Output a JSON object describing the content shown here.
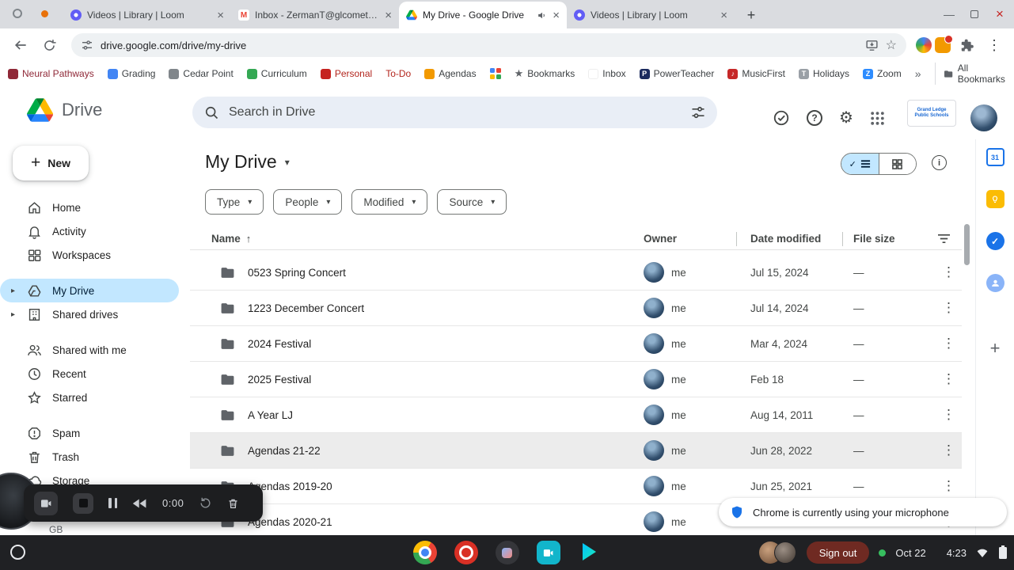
{
  "tabs": [
    {
      "title": "Videos | Library | Loom"
    },
    {
      "title": "Inbox - ZermanT@glcomets.ne"
    },
    {
      "title": "My Drive - Google Drive"
    },
    {
      "title": "Videos | Library | Loom"
    }
  ],
  "toolbar": {
    "url": "drive.google.com/drive/my-drive"
  },
  "bookmarks": {
    "items": [
      {
        "label": "Neural Pathways"
      },
      {
        "label": "Grading"
      },
      {
        "label": "Cedar Point"
      },
      {
        "label": "Curriculum"
      },
      {
        "label": "Personal"
      },
      {
        "label": "To-Do"
      },
      {
        "label": "Agendas"
      },
      {
        "label": "Bookmarks"
      },
      {
        "label": "Inbox"
      },
      {
        "label": "PowerTeacher"
      },
      {
        "label": "MusicFirst"
      },
      {
        "label": "Holidays"
      },
      {
        "label": "Zoom"
      }
    ],
    "all_bookmarks": "All Bookmarks"
  },
  "drive": {
    "app_name": "Drive",
    "search_placeholder": "Search in Drive",
    "org_logo_text": "Grand Ledge Public Schools",
    "new_button": "New",
    "sidebar_items": [
      {
        "label": "Home"
      },
      {
        "label": "Activity"
      },
      {
        "label": "Workspaces"
      },
      {
        "label": "My Drive"
      },
      {
        "label": "Shared drives"
      },
      {
        "label": "Shared with me"
      },
      {
        "label": "Recent"
      },
      {
        "label": "Starred"
      },
      {
        "label": "Spam"
      },
      {
        "label": "Trash"
      },
      {
        "label": "Storage"
      }
    ],
    "storage_fragment": "GB",
    "title": "My Drive",
    "filters": [
      {
        "label": "Type"
      },
      {
        "label": "People"
      },
      {
        "label": "Modified"
      },
      {
        "label": "Source"
      }
    ],
    "columns": {
      "name": "Name",
      "owner": "Owner",
      "modified": "Date modified",
      "size": "File size"
    },
    "rows": [
      {
        "name": "0523 Spring Concert",
        "owner": "me",
        "modified": "Jul 15, 2024",
        "size": "—"
      },
      {
        "name": "1223 December Concert",
        "owner": "me",
        "modified": "Jul 14, 2024",
        "size": "—"
      },
      {
        "name": "2024 Festival",
        "owner": "me",
        "modified": "Mar 4, 2024",
        "size": "—"
      },
      {
        "name": "2025 Festival",
        "owner": "me",
        "modified": "Feb 18",
        "size": "—"
      },
      {
        "name": "A Year LJ",
        "owner": "me",
        "modified": "Aug 14, 2011",
        "size": "—"
      },
      {
        "name": "Agendas 21-22",
        "owner": "me",
        "modified": "Jun 28, 2022",
        "size": "—"
      },
      {
        "name": "Agendas 2019-20",
        "owner": "me",
        "modified": "Jun 25, 2021",
        "size": "—"
      },
      {
        "name": "Agendas 2020-21",
        "owner": "me",
        "modified": "",
        "size": ""
      }
    ]
  },
  "loom": {
    "time": "0:00"
  },
  "notification": {
    "message": "Chrome is currently using your microphone"
  },
  "shelf": {
    "sign_out": "Sign out",
    "date": "Oct 22",
    "time": "4:23"
  }
}
